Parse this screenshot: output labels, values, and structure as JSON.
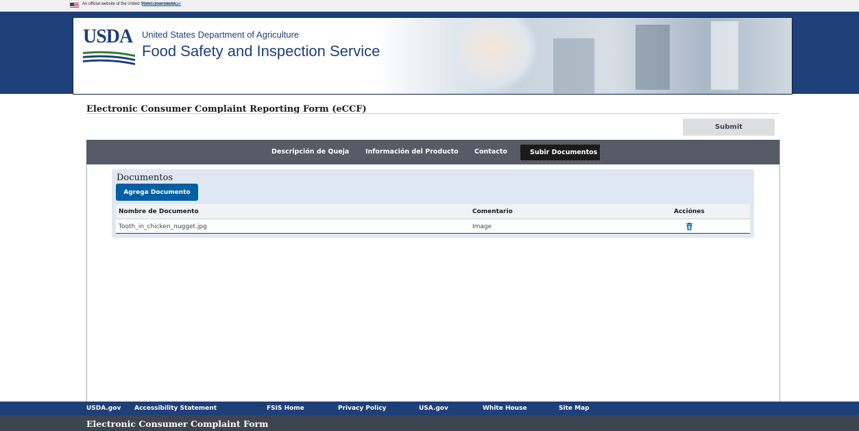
{
  "gov_banner": {
    "text": "An official website of the United States government",
    "link": "Here's how you know"
  },
  "header": {
    "logo_text": "USDA",
    "department": "United States Department of Agriculture",
    "agency": "Food Safety and Inspection Service"
  },
  "form": {
    "title": "Electronic Consumer Complaint Reporting Form (eCCF)",
    "submit_label": "Submit"
  },
  "tabs": {
    "items": [
      {
        "label": "Descripción de Queja"
      },
      {
        "label": "Información del Producto"
      },
      {
        "label": "Contacto"
      },
      {
        "label": "Subir Documentos",
        "active": true
      }
    ]
  },
  "documents": {
    "heading": "Documentos",
    "add_label": "Agrega Documento",
    "columns": [
      "Nombre de Documento",
      "Comentario",
      "Acciónes"
    ],
    "rows": [
      {
        "name": "Tooth_in_chicken_nugget.jpg",
        "comment": "Image",
        "action_icon": "trash-icon"
      }
    ]
  },
  "footer": {
    "links": [
      "USDA.gov",
      "Accessibility Statement",
      "FSIS Home",
      "Privacy Policy",
      "USA.gov",
      "White House",
      "Site Map"
    ],
    "title": "Electronic Consumer Complaint Form"
  },
  "colors": {
    "header_blue": "#1f3f78",
    "tab_bar": "#565c65",
    "primary_button": "#005ea2",
    "docs_panel": "#dfe8f2",
    "footer_dark": "#3d4551"
  }
}
